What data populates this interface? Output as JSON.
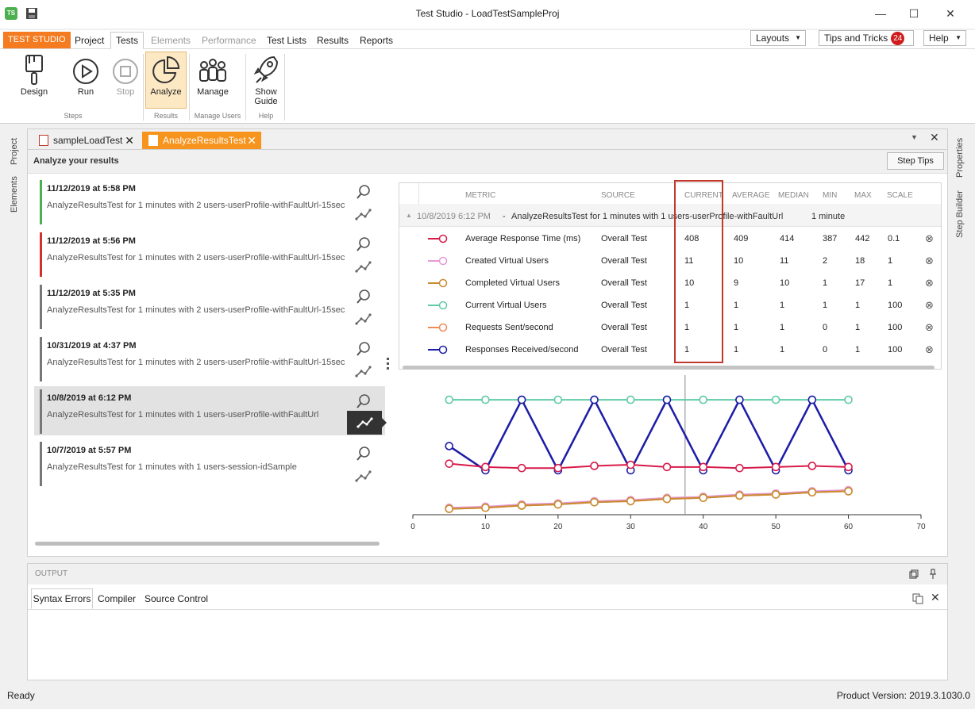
{
  "window": {
    "title": "Test Studio - LoadTestSampleProj",
    "app_icon_text": "TS",
    "minimize": "—",
    "maximize": "☐",
    "close": "✕"
  },
  "menu": {
    "brand": "TEST STUDIO",
    "items": [
      "Project",
      "Tests",
      "Elements",
      "Performance",
      "Test Lists",
      "Results",
      "Reports"
    ],
    "layouts": "Layouts",
    "tips": "Tips and Tricks",
    "tips_count": "24",
    "help": "Help",
    "dropdown_glyph": "▼"
  },
  "ribbon": {
    "design": "Design",
    "run": "Run",
    "stop": "Stop",
    "analyze": "Analyze",
    "manage": "Manage",
    "show_guide_1": "Show",
    "show_guide_2": "Guide",
    "groups": {
      "steps": "Steps",
      "results": "Results",
      "manage_users": "Manage Users",
      "help": "Help"
    }
  },
  "sidetabs": {
    "left": [
      "Project",
      "Elements"
    ],
    "right": [
      "Properties",
      "Step Builder"
    ]
  },
  "doc": {
    "tabs": [
      "sampleLoadTest",
      "AnalyzeResultsTest"
    ],
    "close_glyph": "✕",
    "header": "Analyze your results",
    "step_tips": "Step Tips",
    "dropdown_glyph": "▼"
  },
  "results": [
    {
      "date": "11/12/2019 at 5:58 PM",
      "desc": "AnalyzeResultsTest for 1 minutes with 2 users-userProfile-withFaultUrl-15sec",
      "color": "#4caf50"
    },
    {
      "date": "11/12/2019 at 5:56 PM",
      "desc": "AnalyzeResultsTest for 1 minutes with 2 users-userProfile-withFaultUrl-15sec",
      "color": "#d0312d"
    },
    {
      "date": "11/12/2019 at 5:35 PM",
      "desc": "AnalyzeResultsTest for 1 minutes with 2 users-userProfile-withFaultUrl-15sec",
      "color": "#777777"
    },
    {
      "date": "10/31/2019 at 4:37 PM",
      "desc": "AnalyzeResultsTest for 1 minutes with 2 users-userProfile-withFaultUrl-15sec",
      "color": "#777777"
    },
    {
      "date": "10/8/2019 at 6:12 PM",
      "desc": "AnalyzeResultsTest for 1 minutes with 1 users-userProfile-withFaultUrl",
      "color": "#777777"
    },
    {
      "date": "10/7/2019 at 5:57 PM",
      "desc": "AnalyzeResultsTest for 1 minutes with 1 users-session-idSample",
      "color": "#777777"
    }
  ],
  "metrics": {
    "headers": [
      "METRIC",
      "SOURCE",
      "CURRENT",
      "AVERAGE",
      "MEDIAN",
      "MIN",
      "MAX",
      "SCALE"
    ],
    "group_row": {
      "date": "10/8/2019 6:12 PM",
      "separator": "-",
      "name": "AnalyzeResultsTest for 1 minutes with 1 users-userProfile-withFaultUrl",
      "duration": "1 minute"
    },
    "rows": [
      {
        "metric": "Average Response Time (ms)",
        "source": "Overall Test",
        "current": "408",
        "average": "409",
        "median": "414",
        "min": "387",
        "max": "442",
        "scale": "0.1",
        "color": "#d81b4a"
      },
      {
        "metric": "Created Virtual Users",
        "source": "Overall Test",
        "current": "11",
        "average": "10",
        "median": "11",
        "min": "2",
        "max": "18",
        "scale": "1",
        "color": "#e59ad7"
      },
      {
        "metric": "Completed Virtual Users",
        "source": "Overall Test",
        "current": "10",
        "average": "9",
        "median": "10",
        "min": "1",
        "max": "17",
        "scale": "1",
        "color": "#c98a2e"
      },
      {
        "metric": "Current Virtual Users",
        "source": "Overall Test",
        "current": "1",
        "average": "1",
        "median": "1",
        "min": "1",
        "max": "1",
        "scale": "100",
        "color": "#5fcba7"
      },
      {
        "metric": "Requests Sent/second",
        "source": "Overall Test",
        "current": "1",
        "average": "1",
        "median": "1",
        "min": "0",
        "max": "1",
        "scale": "100",
        "color": "#ee8a5a"
      },
      {
        "metric": "Responses Received/second",
        "source": "Overall Test",
        "current": "1",
        "average": "1",
        "median": "1",
        "min": "0",
        "max": "1",
        "scale": "100",
        "color": "#1c1ca8"
      }
    ],
    "remove_glyph": "⊗",
    "collapse_glyph": "▲",
    "highlight_color": "#c0392b"
  },
  "chart_data": {
    "type": "line",
    "xlim": [
      0,
      70
    ],
    "x_ticks": [
      0,
      10,
      20,
      30,
      40,
      50,
      60,
      70
    ],
    "cursor_x": 37.5,
    "x": [
      5,
      10,
      15,
      20,
      25,
      30,
      35,
      40,
      45,
      50,
      55,
      60
    ],
    "series": [
      {
        "color": "#5fcba7",
        "values": [
          100,
          100,
          100,
          100,
          100,
          100,
          100,
          100,
          100,
          100,
          100,
          100
        ]
      },
      {
        "color": "#1c1ca8",
        "values": [
          58,
          36,
          100,
          36,
          100,
          36,
          100,
          36,
          100,
          36,
          100,
          36
        ]
      },
      {
        "color": "#d81b4a",
        "values": [
          42,
          39,
          38,
          38,
          40,
          41,
          39,
          39,
          38,
          39,
          40,
          39
        ]
      },
      {
        "color": "#e59ad7",
        "values": [
          2,
          3,
          5,
          6,
          8,
          9,
          11,
          12,
          14,
          15,
          17,
          18
        ]
      },
      {
        "color": "#ee8a5a",
        "values": [
          1,
          2,
          4,
          5,
          7,
          8,
          10,
          11,
          13,
          14,
          16,
          17
        ]
      },
      {
        "color": "#c98a2e",
        "values": [
          1,
          2,
          4,
          5,
          7,
          8,
          10,
          11,
          13,
          14,
          16,
          17
        ]
      }
    ],
    "ylim": [
      0,
      108
    ]
  },
  "output": {
    "title": "OUTPUT",
    "tabs": [
      "Syntax Errors",
      "Compiler",
      "Source Control"
    ]
  },
  "status": {
    "left": "Ready",
    "right": "Product Version: 2019.3.1030.0"
  }
}
